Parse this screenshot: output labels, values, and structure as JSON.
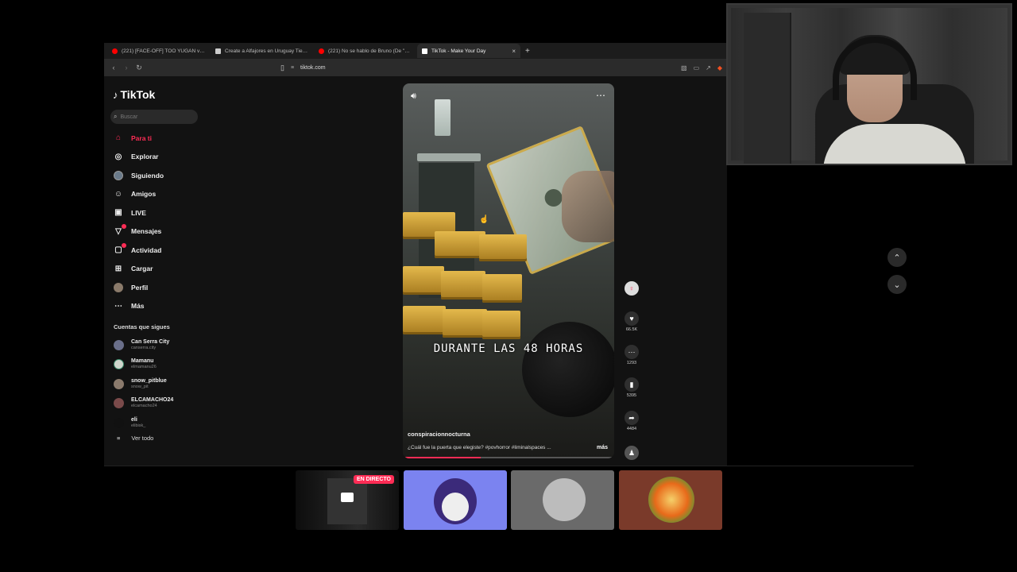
{
  "browser": {
    "tabs": [
      {
        "title": "(221) [FACE-OFF] TOO YUGAN vs MI...",
        "favicon_color": "#ff0000",
        "active": false
      },
      {
        "title": "Create a Alfajores en Uruguay Tier Li...",
        "favicon_color": "#cccccc",
        "active": false
      },
      {
        "title": "(221) No se hablo de Bruno (De \"Enc...",
        "favicon_color": "#ff0000",
        "active": false
      },
      {
        "title": "TikTok - Make Your Day",
        "favicon_color": "#ffffff",
        "active": true
      }
    ],
    "new_tab": "+",
    "close": "×",
    "url": "tiktok.com"
  },
  "tiktok": {
    "logo": "TikTok",
    "search_placeholder": "Buscar",
    "nav": [
      {
        "label": "Para ti",
        "icon": "home-icon",
        "active": true
      },
      {
        "label": "Explorar",
        "icon": "compass-icon"
      },
      {
        "label": "Siguiendo",
        "icon": "following-avatar-icon"
      },
      {
        "label": "Amigos",
        "icon": "friends-icon"
      },
      {
        "label": "LIVE",
        "icon": "live-tv-icon"
      },
      {
        "label": "Mensajes",
        "icon": "messages-icon",
        "badge": true
      },
      {
        "label": "Actividad",
        "icon": "activity-icon",
        "badge": true
      },
      {
        "label": "Cargar",
        "icon": "upload-icon"
      },
      {
        "label": "Perfil",
        "icon": "profile-avatar-icon"
      },
      {
        "label": "Más",
        "icon": "more-icon"
      }
    ],
    "following_title": "Cuentas que sigues",
    "following": [
      {
        "name": "Can Serra City",
        "handle": "canserra.city",
        "avatar_color": "#6a6f8a"
      },
      {
        "name": "Mamanu",
        "handle": "elmamanu26",
        "avatar_color": "#cfd6cc"
      },
      {
        "name": "snow_pitblue",
        "handle": "snow_pit",
        "avatar_color": "#8a7a6c"
      },
      {
        "name": "ELCAMACHO24",
        "handle": "elcamacho24",
        "avatar_color": "#7a4a4a"
      },
      {
        "name": "eli",
        "handle": "elibisk_",
        "avatar_color": "#111111"
      }
    ],
    "see_all": "Ver todo"
  },
  "video": {
    "caption_overlay": "DURANTE LAS 48 HORAS",
    "author": "conspiracionnocturna",
    "description": "¿Cuál fue la puerta que elegiste? #povhorror #liminalspaces ...",
    "more_link": "más",
    "progress": 0.37
  },
  "actions": {
    "likes": "66.5K",
    "comments": "1293",
    "saves": "5395",
    "shares": "4484"
  },
  "bottom": {
    "live_badge": "EN DIRECTO"
  },
  "colors": {
    "accent": "#fe2c55",
    "background": "#121212"
  }
}
